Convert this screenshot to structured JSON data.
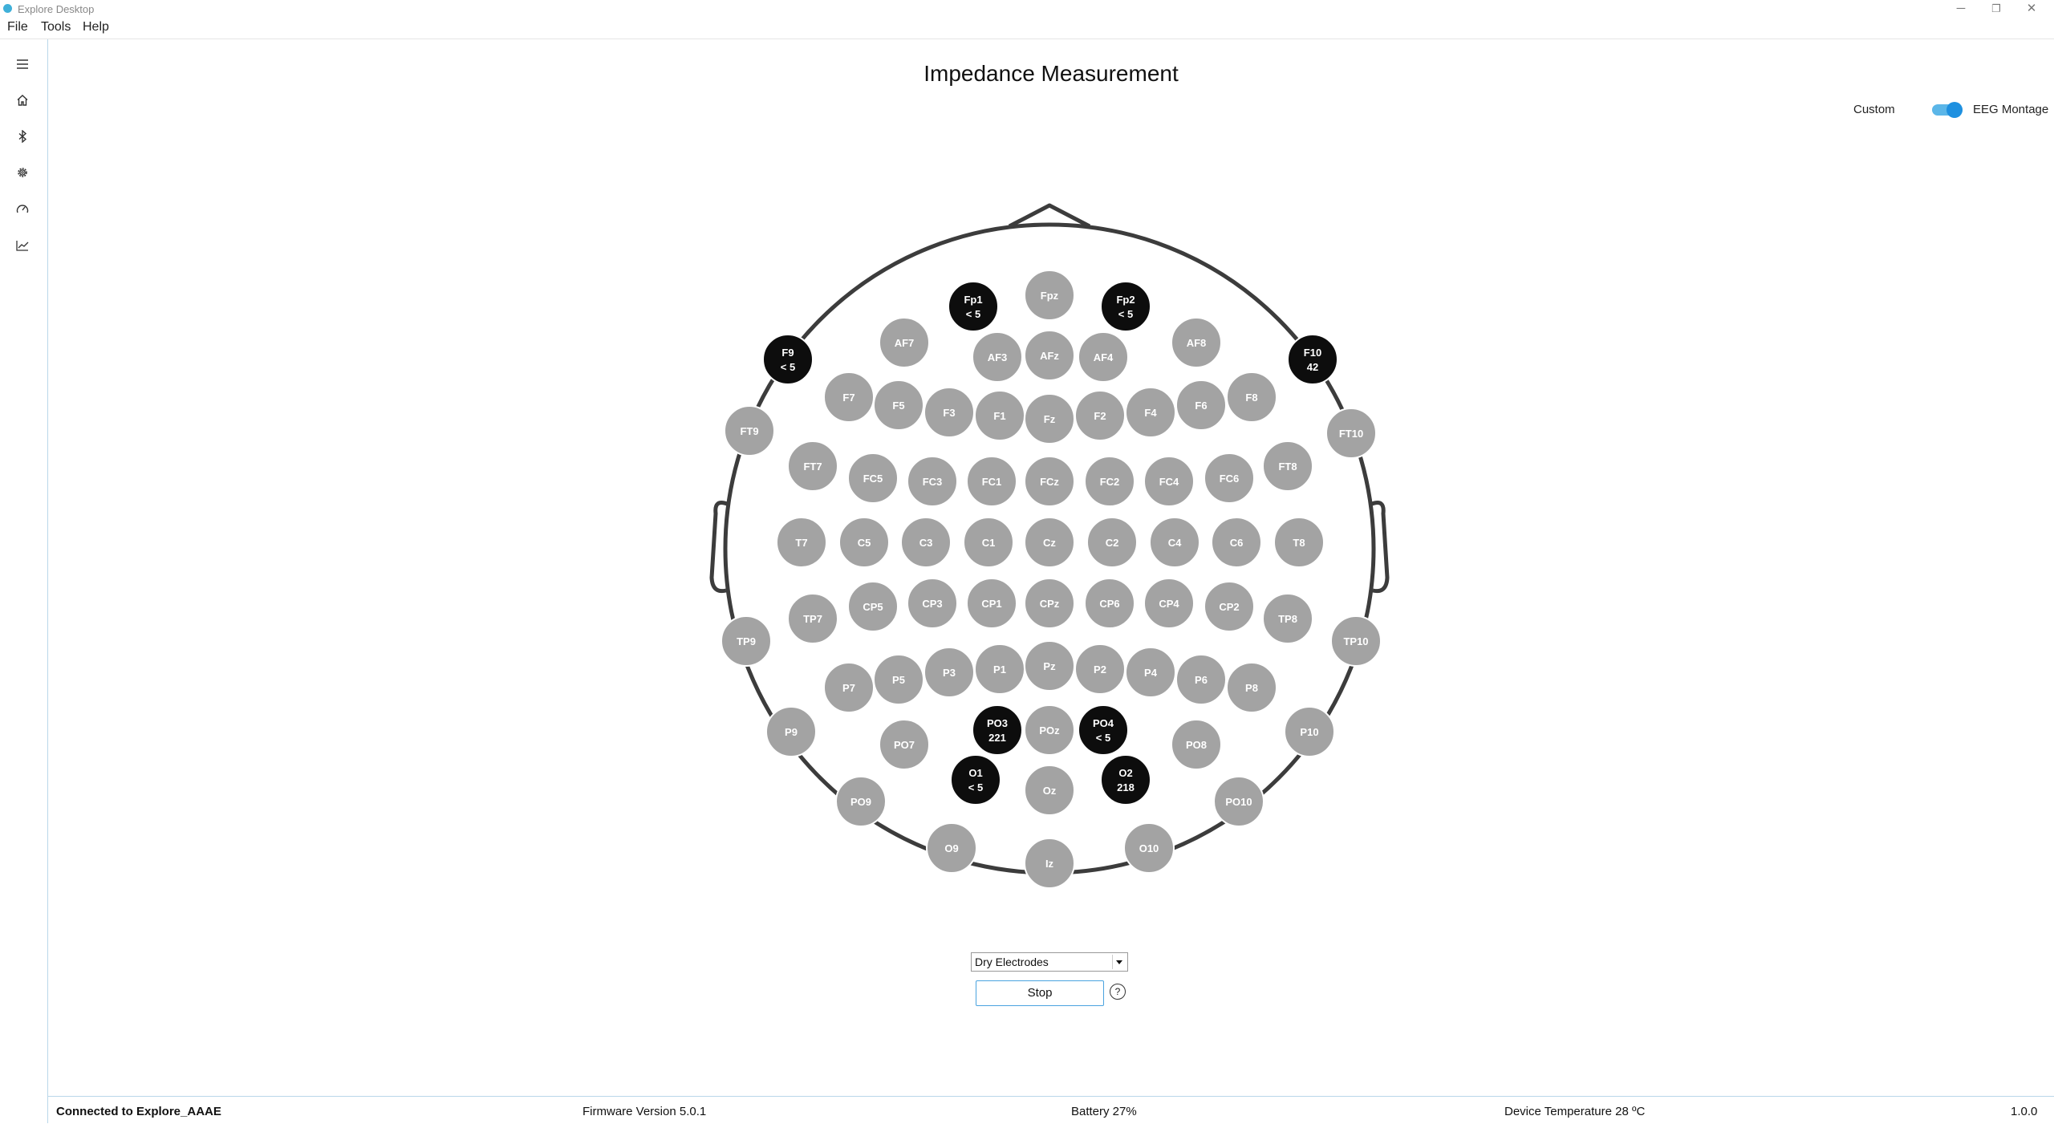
{
  "window": {
    "title": "Explore Desktop",
    "controls": {
      "minimize": "─",
      "maximize": "❐",
      "close": "✕"
    }
  },
  "menu": [
    "File",
    "Tools",
    "Help"
  ],
  "sidebar": {
    "items": [
      {
        "icon": "hamburger-menu-icon"
      },
      {
        "icon": "home-icon"
      },
      {
        "icon": "bluetooth-icon"
      },
      {
        "icon": "gear-icon"
      },
      {
        "icon": "gauge-icon"
      },
      {
        "icon": "line-chart-icon"
      }
    ]
  },
  "main": {
    "title": "Impedance Measurement",
    "toggle": {
      "left_label": "Custom",
      "right_label": "EEG Montage",
      "state": "on",
      "color": "#1e90e0"
    },
    "select": {
      "value": "Dry Electrodes"
    },
    "stop_label": "Stop",
    "help_label": "?"
  },
  "electrodes": [
    {
      "id": "Fpz"
    },
    {
      "id": "Fp1",
      "value": "< 5",
      "active": true
    },
    {
      "id": "Fp2",
      "value": "< 5",
      "active": true
    },
    {
      "id": "AF7"
    },
    {
      "id": "AF3"
    },
    {
      "id": "AFz"
    },
    {
      "id": "AF4"
    },
    {
      "id": "AF8"
    },
    {
      "id": "F9",
      "value": "< 5",
      "active": true
    },
    {
      "id": "F10",
      "value": "42",
      "active": true
    },
    {
      "id": "F7"
    },
    {
      "id": "F5"
    },
    {
      "id": "F3"
    },
    {
      "id": "F1"
    },
    {
      "id": "Fz"
    },
    {
      "id": "F2"
    },
    {
      "id": "F4"
    },
    {
      "id": "F6"
    },
    {
      "id": "F8"
    },
    {
      "id": "FT9"
    },
    {
      "id": "FT10"
    },
    {
      "id": "FT7"
    },
    {
      "id": "FC5"
    },
    {
      "id": "FC3"
    },
    {
      "id": "FC1"
    },
    {
      "id": "FCz"
    },
    {
      "id": "FC2"
    },
    {
      "id": "FC4"
    },
    {
      "id": "FC6"
    },
    {
      "id": "FT8"
    },
    {
      "id": "T7"
    },
    {
      "id": "C5"
    },
    {
      "id": "C3"
    },
    {
      "id": "C1"
    },
    {
      "id": "Cz"
    },
    {
      "id": "C2"
    },
    {
      "id": "C4"
    },
    {
      "id": "C6"
    },
    {
      "id": "T8"
    },
    {
      "id": "TP7"
    },
    {
      "id": "CP5"
    },
    {
      "id": "CP3"
    },
    {
      "id": "CP1"
    },
    {
      "id": "CPz"
    },
    {
      "id": "CP6"
    },
    {
      "id": "CP4"
    },
    {
      "id": "CP2"
    },
    {
      "id": "TP8"
    },
    {
      "id": "TP9"
    },
    {
      "id": "TP10"
    },
    {
      "id": "P7"
    },
    {
      "id": "P5"
    },
    {
      "id": "P3"
    },
    {
      "id": "P1"
    },
    {
      "id": "Pz"
    },
    {
      "id": "P2"
    },
    {
      "id": "P4"
    },
    {
      "id": "P6"
    },
    {
      "id": "P8"
    },
    {
      "id": "P9"
    },
    {
      "id": "P10"
    },
    {
      "id": "PO7"
    },
    {
      "id": "PO3",
      "value": "221",
      "active": true
    },
    {
      "id": "POz"
    },
    {
      "id": "PO4",
      "value": "< 5",
      "active": true
    },
    {
      "id": "PO8"
    },
    {
      "id": "O1",
      "value": "< 5",
      "active": true
    },
    {
      "id": "Oz"
    },
    {
      "id": "O2",
      "value": "218",
      "active": true
    },
    {
      "id": "PO9"
    },
    {
      "id": "PO10"
    },
    {
      "id": "O9"
    },
    {
      "id": "Iz"
    },
    {
      "id": "O10"
    }
  ],
  "colors": {
    "inactive": "#a3a3a3",
    "active": "#0d0d0d",
    "head_outline": "#3c3c3c"
  },
  "status": {
    "connection": "Connected to Explore_AAAE",
    "firmware": "Firmware Version  5.0.1",
    "battery": "Battery  27%",
    "temperature": "Device Temperature  28 ºC",
    "version": "1.0.0"
  }
}
